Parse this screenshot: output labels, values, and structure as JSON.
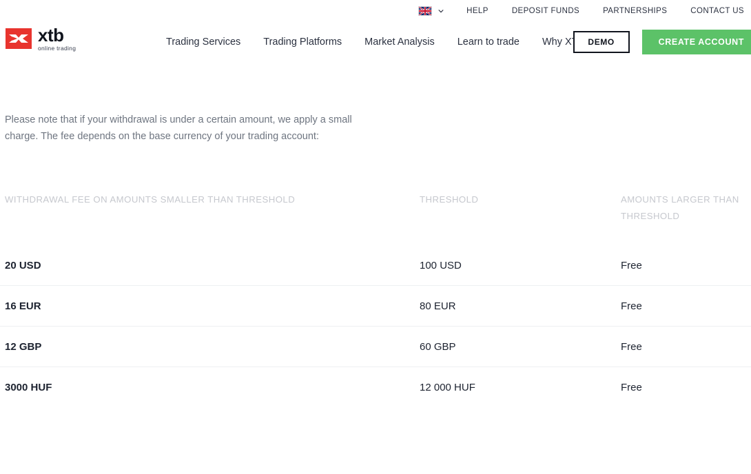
{
  "topbar": {
    "language": {
      "icon": "uk-flag-icon",
      "chevron": "chevron-down-icon"
    },
    "links": [
      {
        "label": "HELP"
      },
      {
        "label": "DEPOSIT FUNDS"
      },
      {
        "label": "PARTNERSHIPS"
      },
      {
        "label": "CONTACT US"
      }
    ]
  },
  "brand": {
    "word": "xtb",
    "tagline": "online trading",
    "mark_color": "#e8342e"
  },
  "nav": {
    "items": [
      {
        "label": "Trading Services"
      },
      {
        "label": "Trading Platforms"
      },
      {
        "label": "Market Analysis"
      },
      {
        "label": "Learn to trade"
      },
      {
        "label": "Why XTB"
      }
    ]
  },
  "actions": {
    "demo_label": "DEMO",
    "create_label": "CREATE ACCOUNT",
    "create_color": "#5cc268"
  },
  "main": {
    "intro": "Please note that if your withdrawal is under a certain amount, we apply a small charge. The fee depends on the base currency of your trading account:"
  },
  "table": {
    "headers": [
      "WITHDRAWAL FEE ON AMOUNTS SMALLER THAN THRESHOLD",
      "THRESHOLD",
      "AMOUNTS LARGER THAN THRESHOLD"
    ],
    "rows": [
      {
        "fee": "20 USD",
        "threshold": "100 USD",
        "larger": "Free"
      },
      {
        "fee": "16 EUR",
        "threshold": "80 EUR",
        "larger": "Free"
      },
      {
        "fee": "12 GBP",
        "threshold": "60 GBP",
        "larger": "Free"
      },
      {
        "fee": "3000 HUF",
        "threshold": "12 000 HUF",
        "larger": "Free"
      }
    ]
  },
  "colors": {
    "text_dark": "#1d2330",
    "text_muted": "#6e7580",
    "header_muted": "#c6c8ce",
    "divider": "#eef0f2"
  }
}
